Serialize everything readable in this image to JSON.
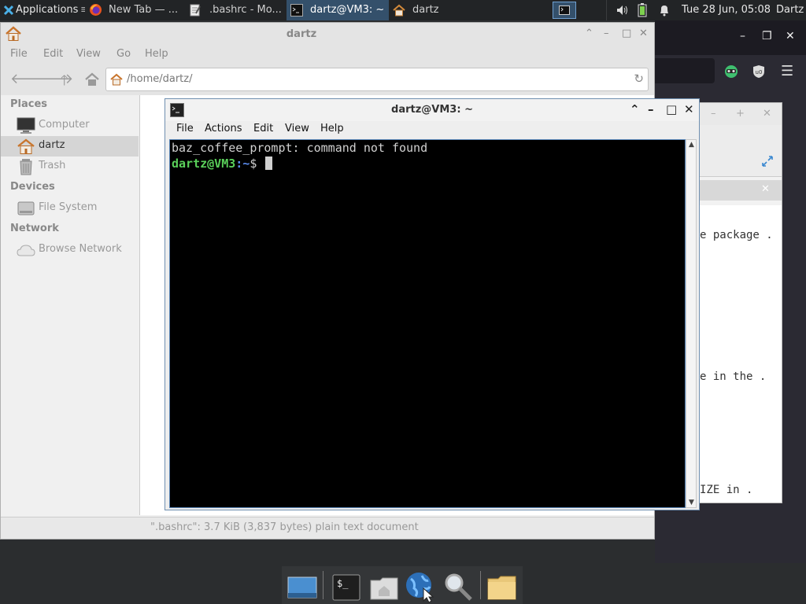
{
  "panel": {
    "applications_label": "Applications",
    "tasks": [
      {
        "label": "New Tab — ..."
      },
      {
        "label": ".bashrc - Mo..."
      },
      {
        "label": "dartz@VM3: ~"
      },
      {
        "label": "dartz"
      }
    ],
    "datetime": "Tue 28 Jun, 05:08",
    "user": "Dartz"
  },
  "file_manager": {
    "title": "dartz",
    "menu": [
      "File",
      "Edit",
      "View",
      "Go",
      "Help"
    ],
    "path": "/home/dartz/",
    "sidebar": {
      "places_heading": "Places",
      "places": [
        {
          "label": "Computer",
          "icon": "computer-icon"
        },
        {
          "label": "dartz",
          "icon": "home-folder-icon",
          "selected": true
        },
        {
          "label": "Trash",
          "icon": "trash-icon"
        }
      ],
      "devices_heading": "Devices",
      "devices": [
        {
          "label": "File System",
          "icon": "drive-icon"
        }
      ],
      "network_heading": "Network",
      "network": [
        {
          "label": "Browse Network",
          "icon": "network-icon"
        }
      ]
    },
    "status": "\".bashrc\": 3.7 KiB (3,837 bytes) plain text document"
  },
  "terminal": {
    "title": "dartz@VM3: ~",
    "menu": [
      "File",
      "Actions",
      "Edit",
      "View",
      "Help"
    ],
    "output_line": "baz_coffee_prompt: command not found",
    "prompt_user": "dartz@VM3",
    "prompt_path": ":~",
    "prompt_symbol": "$"
  },
  "editor_fragments": {
    "line1": "e package .",
    "line2": "e in the .",
    "line3": "IZE in ."
  },
  "colors": {
    "terminal_bg": "#000000",
    "prompt_green": "#5ad05a",
    "prompt_blue": "#5b8df0",
    "panel_bg": "#222426",
    "active_task": "#34506b"
  }
}
